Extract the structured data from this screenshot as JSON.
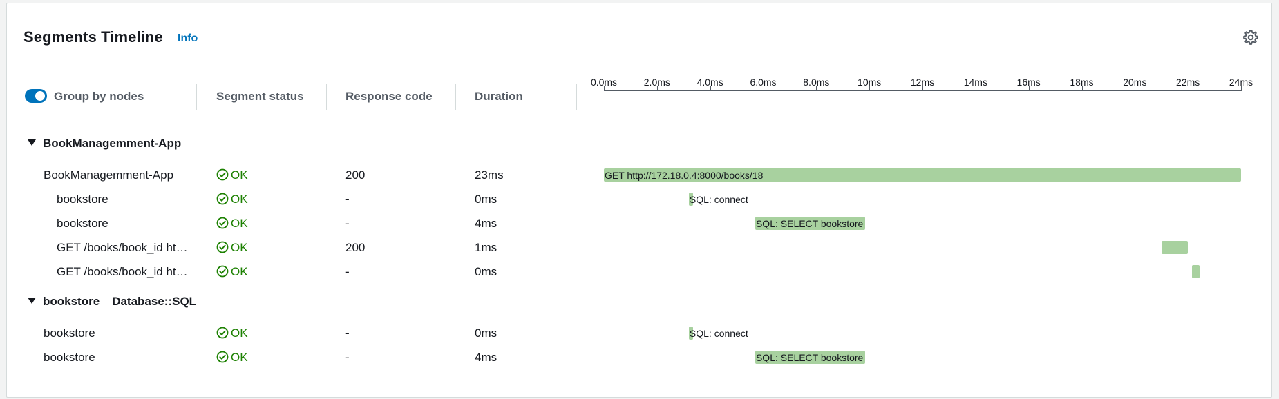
{
  "panel": {
    "title": "Segments Timeline",
    "info_link": "Info",
    "settings_icon": "gear-icon"
  },
  "controls": {
    "group_by_nodes_label": "Group by nodes",
    "group_by_nodes_on": true
  },
  "columns": {
    "segment_status": "Segment status",
    "response_code": "Response code",
    "duration": "Duration"
  },
  "axis": {
    "unit": "ms",
    "ticks": [
      "0.0ms",
      "2.0ms",
      "4.0ms",
      "6.0ms",
      "8.0ms",
      "10ms",
      "12ms",
      "14ms",
      "16ms",
      "18ms",
      "20ms",
      "22ms",
      "24ms"
    ],
    "range_ms": [
      0,
      24
    ]
  },
  "groups": [
    {
      "name": "BookManagemment-App",
      "type": "",
      "rows": [
        {
          "name": "BookManagemment-App",
          "status": "OK",
          "code": "200",
          "duration": "23ms",
          "bar_start_ms": 0.0,
          "bar_end_ms": 24.0,
          "bar_label": "GET http://172.18.0.4:8000/books/18",
          "indent": 0
        },
        {
          "name": "bookstore",
          "status": "OK",
          "code": "-",
          "duration": "0ms",
          "bar_start_ms": 3.2,
          "bar_end_ms": 3.35,
          "bar_label": "SQL: connect",
          "indent": 1
        },
        {
          "name": "bookstore",
          "status": "OK",
          "code": "-",
          "duration": "4ms",
          "bar_start_ms": 5.7,
          "bar_end_ms": 9.85,
          "bar_label": "SQL: SELECT bookstore",
          "indent": 1
        },
        {
          "name": "GET /books/book_id ht…",
          "status": "OK",
          "code": "200",
          "duration": "1ms",
          "bar_start_ms": 21.0,
          "bar_end_ms": 22.0,
          "bar_label": "",
          "indent": 1
        },
        {
          "name": "GET /books/book_id ht…",
          "status": "OK",
          "code": "-",
          "duration": "0ms",
          "bar_start_ms": 22.15,
          "bar_end_ms": 22.45,
          "bar_label": "",
          "indent": 1
        }
      ]
    },
    {
      "name": "bookstore",
      "type": "Database::SQL",
      "rows": [
        {
          "name": "bookstore",
          "status": "OK",
          "code": "-",
          "duration": "0ms",
          "bar_start_ms": 3.2,
          "bar_end_ms": 3.35,
          "bar_label": "SQL: connect",
          "indent": 0
        },
        {
          "name": "bookstore",
          "status": "OK",
          "code": "-",
          "duration": "4ms",
          "bar_start_ms": 5.7,
          "bar_end_ms": 9.85,
          "bar_label": "SQL: SELECT bookstore",
          "indent": 0
        }
      ]
    }
  ],
  "colors": {
    "bar": "#a8d19f",
    "ok": "#1d8102",
    "link": "#0073bb"
  }
}
